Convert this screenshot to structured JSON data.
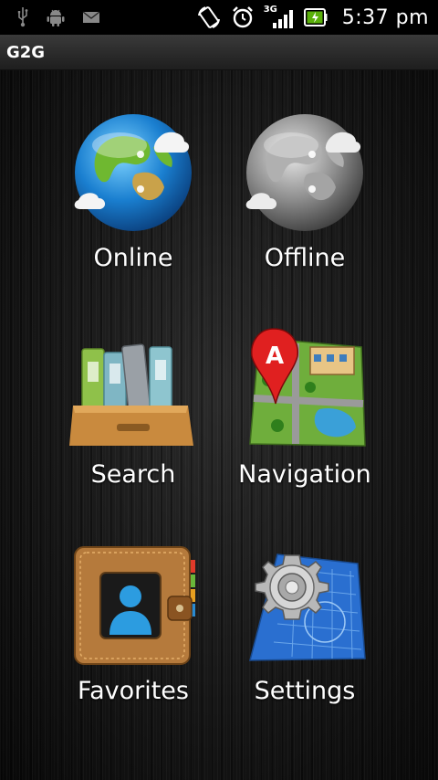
{
  "status_bar": {
    "time": "5:37 pm",
    "network": "3G",
    "left_icons": [
      "usb-icon",
      "android-icon",
      "mail-icon"
    ],
    "right_icons": [
      "rotate-icon",
      "alarm-icon",
      "signal-icon",
      "battery-icon"
    ]
  },
  "app": {
    "title": "G2G"
  },
  "menu": {
    "online": "Online",
    "offline": "Offline",
    "search": "Search",
    "navigation": "Navigation",
    "favorites": "Favorites",
    "settings": "Settings"
  },
  "colors": {
    "background": "#000000",
    "title_bar": "#2a2a2a",
    "text": "#ffffff",
    "battery_fill": "#5ab00a"
  }
}
